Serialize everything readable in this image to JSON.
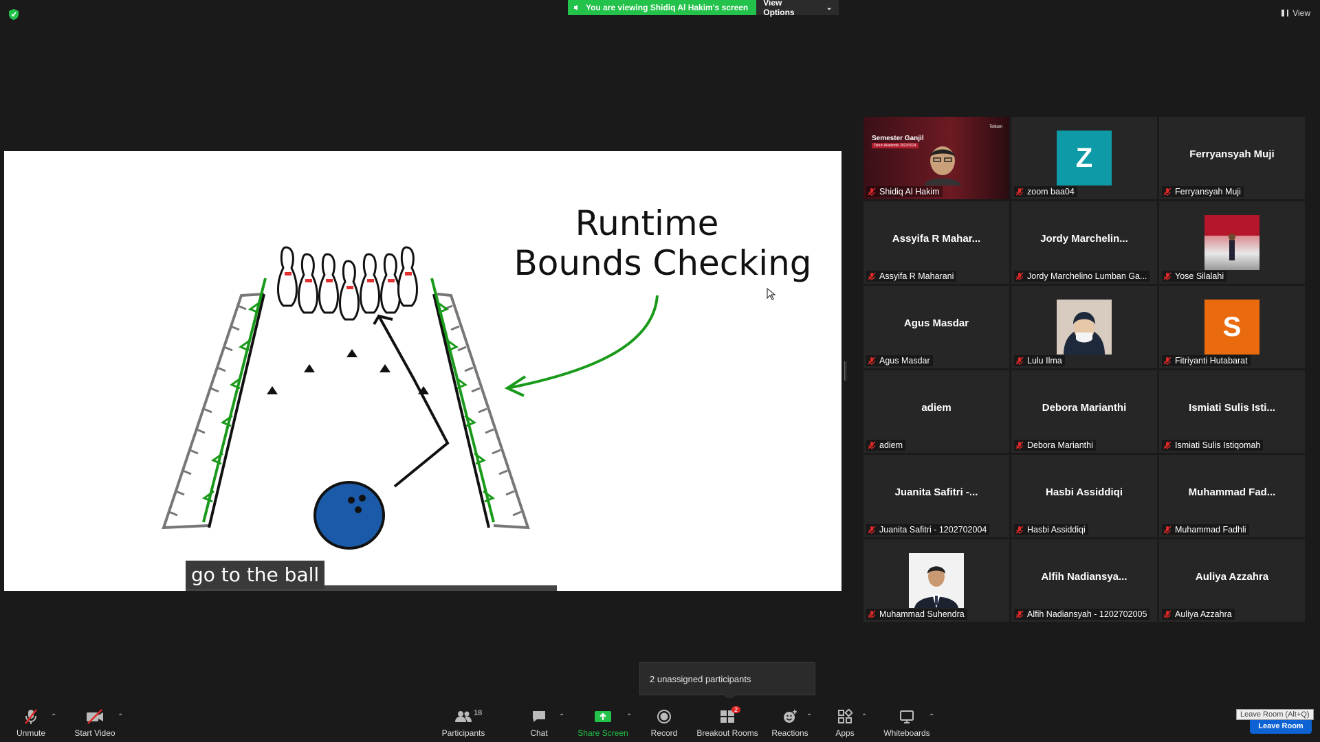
{
  "banner": {
    "viewing_text": "You are viewing Shidiq Al Hakim's screen",
    "view_options_label": "View Options"
  },
  "top_right": {
    "view_label": "View"
  },
  "slide": {
    "title_line1": "Runtime",
    "title_line2": "Bounds Checking",
    "caption": "go to the ball"
  },
  "presenter_slide": {
    "title": "Semester Ganjil",
    "subtitle": "Tahun Akademik 2023/2024",
    "logo": "Telkom"
  },
  "participants": [
    {
      "display": "",
      "label": "Shidiq Al Hakim",
      "type": "presenter"
    },
    {
      "display": "Z",
      "label": "zoom baa04",
      "type": "letter",
      "color": "#0e9aa7"
    },
    {
      "display": "Ferryansyah Muji",
      "label": "Ferryansyah Muji",
      "type": "name"
    },
    {
      "display": "Assyifa R Mahar...",
      "label": "Assyifa R Maharani",
      "type": "name"
    },
    {
      "display": "Jordy  Marchelin...",
      "label": "Jordy Marchelino Lumban Ga...",
      "type": "name"
    },
    {
      "display": "",
      "label": "Yose Silalahi",
      "type": "photo-red"
    },
    {
      "display": "Agus Masdar",
      "label": "Agus Masdar",
      "type": "name"
    },
    {
      "display": "",
      "label": "Lulu Ilma",
      "type": "photo-hijab"
    },
    {
      "display": "S",
      "label": "Fitriyanti Hutabarat",
      "type": "letter",
      "color": "#ea6a0e"
    },
    {
      "display": "adiem",
      "label": "adiem",
      "type": "name"
    },
    {
      "display": "Debora Marianthi",
      "label": "Debora Marianthi",
      "type": "name"
    },
    {
      "display": "Ismiati Sulis Isti...",
      "label": "Ismiati Sulis Istiqomah",
      "type": "name"
    },
    {
      "display": "Juanita Safitri -...",
      "label": "Juanita Safitri - 1202702004",
      "type": "name"
    },
    {
      "display": "Hasbi Assiddiqi",
      "label": "Hasbi Assiddiqi",
      "type": "name"
    },
    {
      "display": "Muhammad  Fad...",
      "label": "Muhammad Fadhli",
      "type": "name"
    },
    {
      "display": "",
      "label": "Muhammad Suhendra",
      "type": "photo-suit"
    },
    {
      "display": "Alfih  Nadiansya...",
      "label": "Alfih Nadiansyah - 1202702005",
      "type": "name"
    },
    {
      "display": "Auliya Azzahra",
      "label": "Auliya Azzahra",
      "type": "name"
    }
  ],
  "unassigned_text": "2 unassigned participants",
  "toolbar": {
    "unmute": "Unmute",
    "start_video": "Start Video",
    "participants": "Participants",
    "participants_count": "18",
    "chat": "Chat",
    "share_screen": "Share Screen",
    "record": "Record",
    "breakout_rooms": "Breakout Rooms",
    "breakout_badge": "2",
    "reactions": "Reactions",
    "apps": "Apps",
    "whiteboards": "Whiteboards",
    "leave_tooltip": "Leave Room (Alt+Q)",
    "leave_button": "Leave Room"
  },
  "colors": {
    "share_green": "#23c24a",
    "active_border": "#e7e85a",
    "leave_blue": "#0e63d4"
  }
}
